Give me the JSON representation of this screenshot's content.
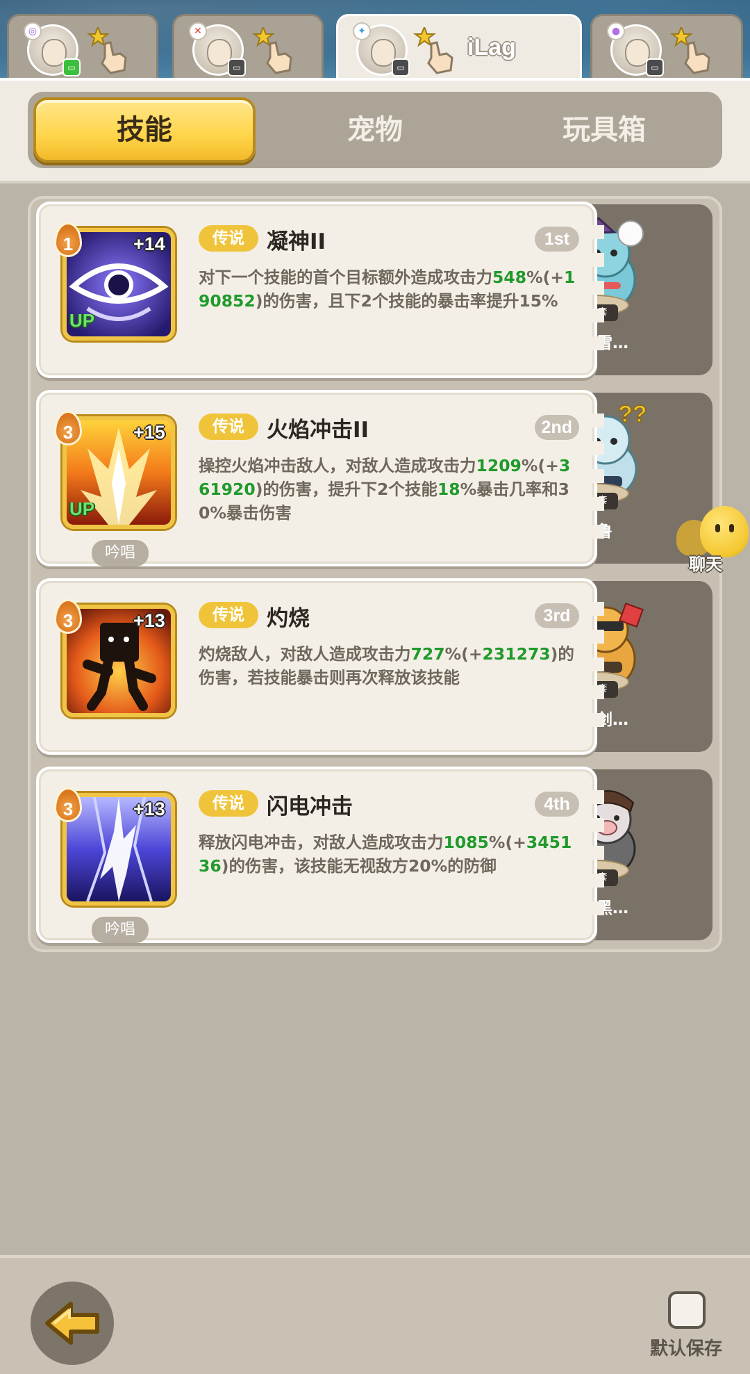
{
  "players": [
    {
      "name": "",
      "active": false
    },
    {
      "name": "",
      "active": false
    },
    {
      "name": "iLag",
      "active": true
    },
    {
      "name": "",
      "active": false
    }
  ],
  "subtabs": [
    {
      "label": "技能",
      "active": true
    },
    {
      "label": "宠物",
      "active": false
    },
    {
      "label": "玩具箱",
      "active": false
    }
  ],
  "skills": [
    {
      "level": "1",
      "plus": "+14",
      "up": "UP",
      "chant": "",
      "tag": "传说",
      "name": "凝神II",
      "rank": "1st",
      "desc_parts": [
        "对下一个技能的首个目标额外造成攻击力",
        "548",
        "%(+",
        "190852",
        ")的伤害，且下2个技能的暴击率提升15%"
      ],
      "pet_set": "六件套",
      "pet_name": "快乐的雪…"
    },
    {
      "level": "3",
      "plus": "+15",
      "up": "UP",
      "chant": "吟唱",
      "tag": "传说",
      "name": "火焰冲击II",
      "rank": "2nd",
      "desc_parts": [
        "操控火焰冲击敌人，对敌人造成攻击力",
        "1209",
        "%(+",
        "361920",
        ")的伤害，提升下2个技能",
        "18",
        "%暴击几率和30%暴击伤害"
      ],
      "pet_set": "六件套",
      "pet_name": "困惑的鲁"
    },
    {
      "level": "3",
      "plus": "+13",
      "up": "",
      "chant": "",
      "tag": "传说",
      "name": "灼烧",
      "rank": "3rd",
      "desc_parts": [
        "灼烧敌人，对敌人造成攻击力",
        "727",
        "%(+",
        "231273",
        ")的伤害，若技能暴击则再次释放该技能"
      ],
      "pet_set": "六件套",
      "pet_name": "暴躁的剑…"
    },
    {
      "level": "3",
      "plus": "+13",
      "up": "",
      "chant": "吟唱",
      "tag": "传说",
      "name": "闪电冲击",
      "rank": "4th",
      "desc_parts": [
        "释放闪电冲击，对敌人造成攻击力",
        "1085",
        "%(+",
        "345136",
        ")的伤害，该技能无视敌方20%的防御"
      ],
      "pet_set": "六件套",
      "pet_name": "活跃的黑…"
    }
  ],
  "chat": {
    "label": "聊天"
  },
  "bottom": {
    "default_save": "默认保存"
  },
  "icons": {
    "back": "back-arrow-icon",
    "hand": "pointing-hand-icon",
    "checkbox": "checkbox-icon"
  },
  "colors": {
    "gold": "#f0c43a",
    "green_value": "#1f9a2c",
    "active_tab": "#ffd54a"
  }
}
